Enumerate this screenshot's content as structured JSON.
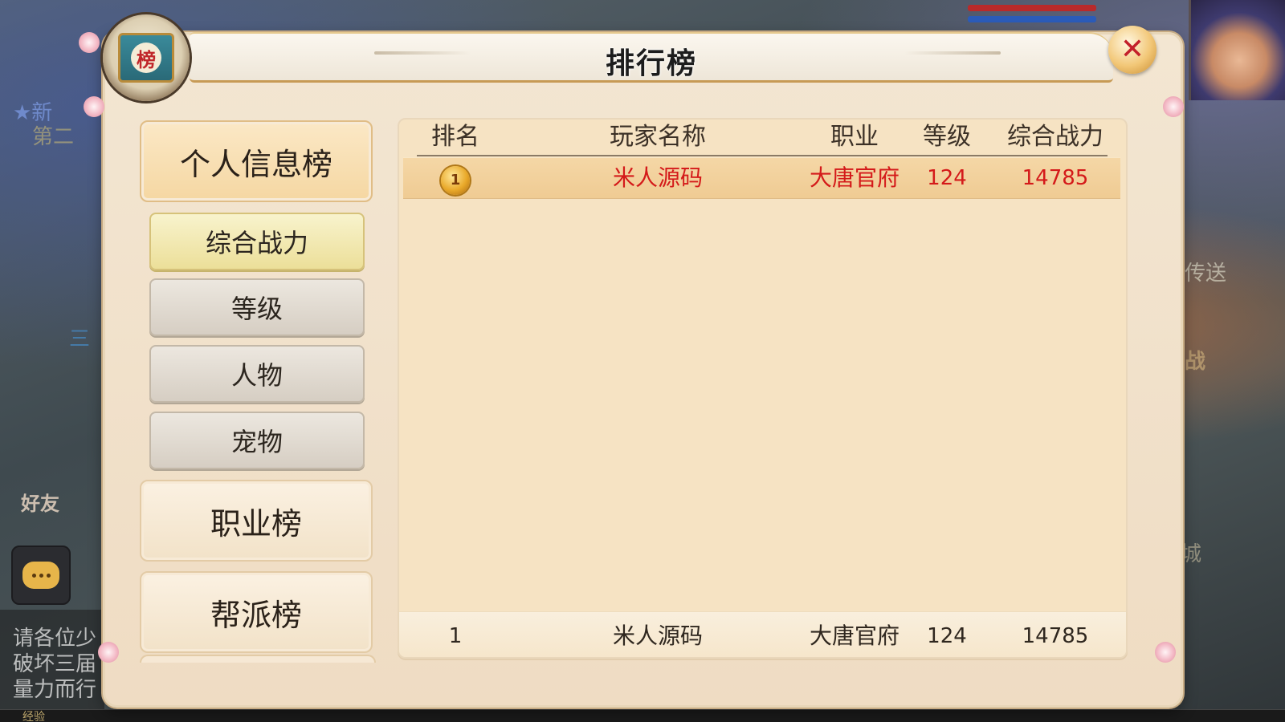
{
  "background": {
    "quest_line_1": "★新",
    "quest_line_2": "第二",
    "quest_line_3": "三",
    "right_label_1": "传送",
    "right_label_2": "战",
    "right_label_3": "城",
    "friend_label": "好友",
    "chat_lines": [
      "请各位少",
      "破坏三届",
      "量力而行"
    ],
    "exp_label": "经验"
  },
  "window": {
    "title": "排行榜",
    "emblem_glyph": "榜",
    "close_glyph": "✕"
  },
  "menu": {
    "categories": [
      {
        "label": "个人信息榜",
        "active": true
      },
      {
        "label": "职业榜",
        "active": false
      },
      {
        "label": "帮派榜",
        "active": false
      }
    ],
    "subtabs": [
      {
        "label": "综合战力",
        "active": true
      },
      {
        "label": "等级",
        "active": false
      },
      {
        "label": "人物",
        "active": false
      },
      {
        "label": "宠物",
        "active": false
      }
    ]
  },
  "table": {
    "headers": {
      "rank": "排名",
      "name": "玩家名称",
      "job": "职业",
      "level": "等级",
      "power": "综合战力"
    },
    "rows": [
      {
        "rank": "1",
        "rank_icon": "gold-medal-icon",
        "name": "米人源码",
        "job": "大唐官府",
        "level": "124",
        "power": "14785"
      }
    ],
    "my_row": {
      "rank": "1",
      "name": "米人源码",
      "job": "大唐官府",
      "level": "124",
      "power": "14785"
    }
  },
  "colors": {
    "highlight_text": "#d41a1a",
    "panel_bg": "#f3e6d2",
    "active_row": "#f5d7a6",
    "close_red": "#c3202a"
  }
}
